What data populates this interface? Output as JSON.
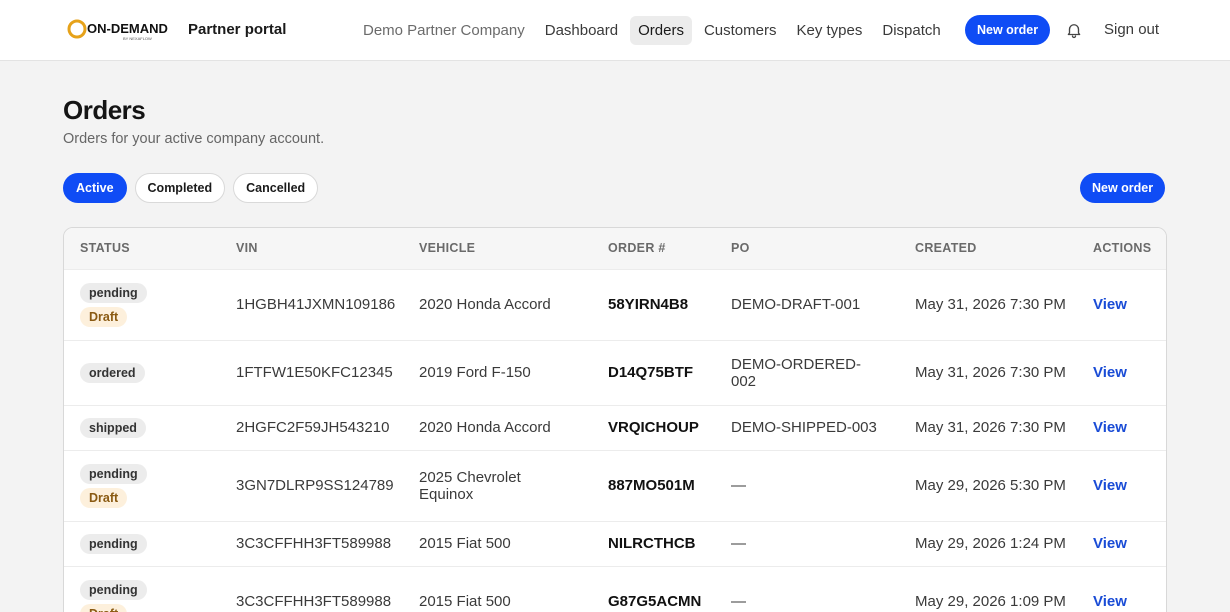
{
  "header": {
    "logo_text": "ON-DEMAND",
    "logo_sub": "BY NEXAFLOW",
    "portal_title": "Partner portal",
    "company": "Demo Partner Company",
    "nav": [
      {
        "label": "Dashboard",
        "active": false
      },
      {
        "label": "Orders",
        "active": true
      },
      {
        "label": "Customers",
        "active": false
      },
      {
        "label": "Key types",
        "active": false
      },
      {
        "label": "Dispatch",
        "active": false
      }
    ],
    "new_order_label": "New order",
    "bell_icon": "bell-icon",
    "signout_label": "Sign out"
  },
  "page": {
    "title": "Orders",
    "subtitle": "Orders for your active company account.",
    "filters": [
      {
        "label": "Active",
        "active": true
      },
      {
        "label": "Completed",
        "active": false
      },
      {
        "label": "Cancelled",
        "active": false
      }
    ],
    "new_order_label": "New order"
  },
  "table": {
    "columns": [
      "STATUS",
      "VIN",
      "VEHICLE",
      "ORDER #",
      "PO",
      "CREATED",
      "ACTIONS"
    ],
    "rows": [
      {
        "status": "pending",
        "draft": "Draft",
        "vin": "1HGBH41JXMN109186",
        "vehicle": "2020 Honda Accord",
        "order": "58YIRN4B8",
        "po": "DEMO-DRAFT-001",
        "created": "May 31, 2026 7:30 PM",
        "action": "View"
      },
      {
        "status": "ordered",
        "draft": "",
        "vin": "1FTFW1E50KFC12345",
        "vehicle": "2019 Ford F-150",
        "order": "D14Q75BTF",
        "po": "DEMO-ORDERED-002",
        "created": "May 31, 2026 7:30 PM",
        "action": "View"
      },
      {
        "status": "shipped",
        "draft": "",
        "vin": "2HGFC2F59JH543210",
        "vehicle": "2020 Honda Accord",
        "order": "VRQICHOUP",
        "po": "DEMO-SHIPPED-003",
        "created": "May 31, 2026 7:30 PM",
        "action": "View"
      },
      {
        "status": "pending",
        "draft": "Draft",
        "vin": "3GN7DLRP9SS124789",
        "vehicle": "2025 Chevrolet Equinox",
        "order": "887MO501M",
        "po": "—",
        "created": "May 29, 2026 5:30 PM",
        "action": "View"
      },
      {
        "status": "pending",
        "draft": "",
        "vin": "3C3CFFHH3FT589988",
        "vehicle": "2015 Fiat 500",
        "order": "NILRCTHCB",
        "po": "—",
        "created": "May 29, 2026 1:24 PM",
        "action": "View"
      },
      {
        "status": "pending",
        "draft": "Draft",
        "vin": "3C3CFFHH3FT589988",
        "vehicle": "2015 Fiat 500",
        "order": "G87G5ACMN",
        "po": "—",
        "created": "May 29, 2026 1:09 PM",
        "action": "View"
      }
    ]
  },
  "colors": {
    "accent": "#0f4cf5",
    "link": "#1a4cd6",
    "draft_bg": "#fdf0dc"
  }
}
